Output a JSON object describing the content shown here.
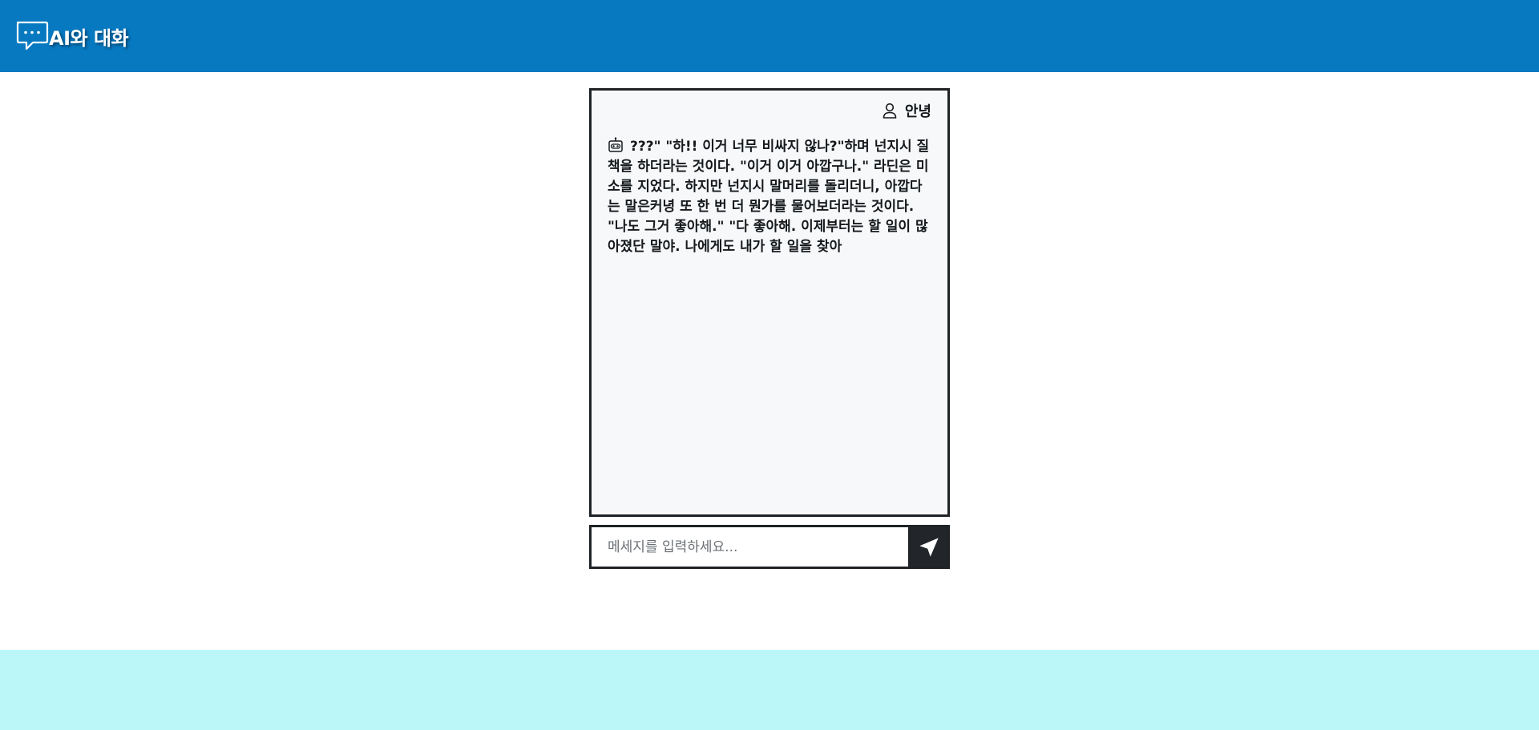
{
  "header": {
    "title": "AI와 대화",
    "icon": "chat-bubble-icon",
    "background_color": "#0779c1"
  },
  "chat": {
    "user_label": "안녕",
    "user_icon": "person-icon",
    "bot_icon": "robot-icon",
    "bot_message": "???\" \"하!! 이거 너무 비싸지 않나?\"하며 넌지시 질책을 하더라는 것이다. \"이거 이거 아깝구나.\" 라딘은 미소를 지었다. 하지만 넌지시 말머리를 돌리더니, 아깝다는 말은커녕 또 한 번 더 뭔가를 물어보더라는 것이다. \"나도 그거 좋아해.\" \"다 좋아해. 이제부터는 할 일이 많아졌단 말야. 나에게도 내가 할 일을 찾아"
  },
  "input": {
    "placeholder": "메세지를 입력하세요...",
    "value": "",
    "send_icon": "send-arrow-icon"
  },
  "footer": {
    "background_color": "#bbf6f9"
  }
}
